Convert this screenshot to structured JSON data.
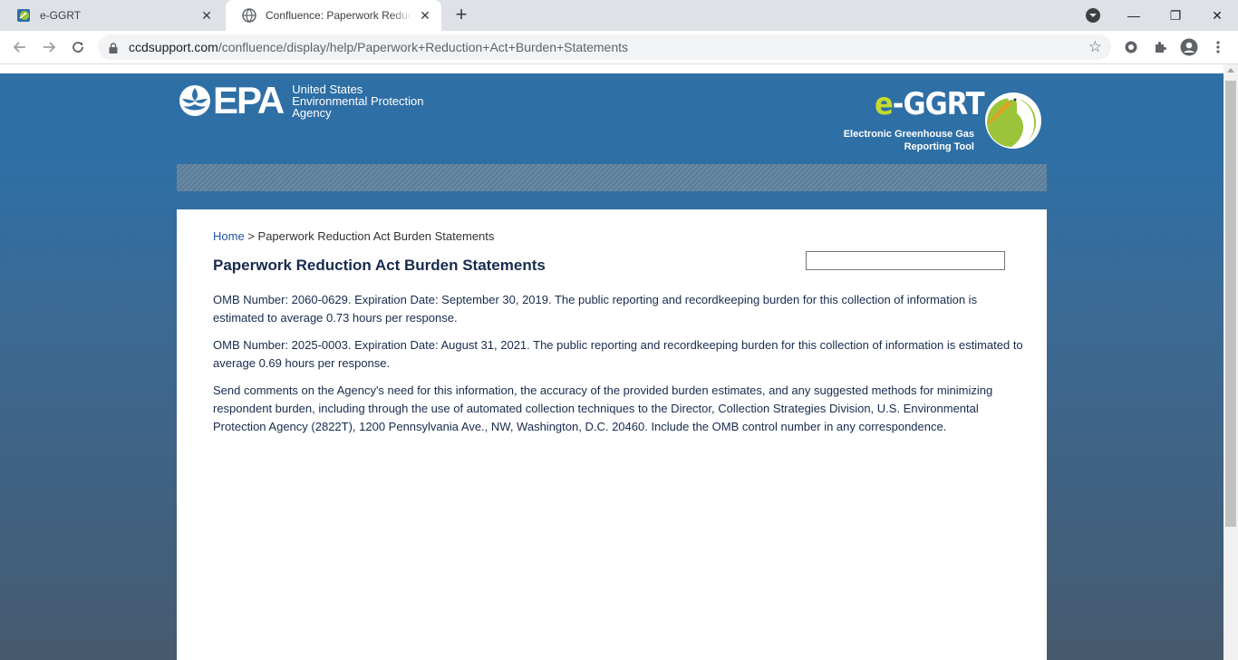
{
  "browser": {
    "tabs": [
      {
        "title": "e-GGRT",
        "active": false
      },
      {
        "title": "Confluence: Paperwork Reduction Act Burden Statements",
        "active": true
      }
    ],
    "url_host": "ccdsupport.com",
    "url_path": "/confluence/display/help/Paperwork+Reduction+Act+Burden+Statements"
  },
  "header": {
    "epa_word": "EPA",
    "epa_line1": "United States",
    "epa_line2": "Environmental Protection",
    "epa_line3": "Agency",
    "eggrt_e": "e",
    "eggrt_rest": "-GGRT",
    "eggrt_line1": "Electronic Greenhouse Gas",
    "eggrt_line2": "Reporting Tool"
  },
  "breadcrumb": {
    "home": "Home",
    "separator": ">",
    "current": "Paperwork Reduction Act Burden Statements"
  },
  "page": {
    "title": "Paperwork Reduction Act Burden Statements",
    "search_placeholder": "",
    "paragraphs": [
      "OMB Number: 2060-0629. Expiration Date: September 30, 2019. The public reporting and recordkeeping burden for this collection of information is estimated to average 0.73 hours per response.",
      "OMB Number: 2025-0003. Expiration Date: August 31, 2021. The public reporting and recordkeeping burden for this collection of information is estimated to average 0.69 hours per response.",
      "Send comments on the Agency's need for this information, the accuracy of the provided burden estimates, and any suggested methods for minimizing respondent burden, including through the use of automated collection techniques to the Director, Collection Strategies Division, U.S. Environmental Protection Agency (2822T), 1200 Pennsylvania Ave., NW, Washington, D.C. 20460. Include the OMB control number in any correspondence."
    ]
  },
  "colors": {
    "header_blue": "#2e6fa5",
    "title_text": "#172b4d",
    "link": "#2255a4",
    "eggrt_green": "#c6d92e"
  }
}
